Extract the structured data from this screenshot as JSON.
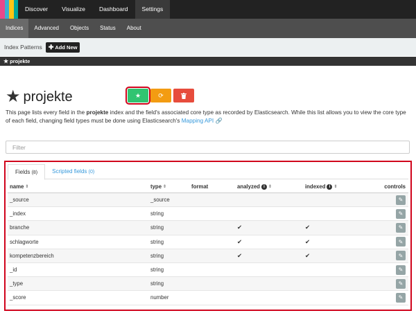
{
  "topnav": {
    "logo_colors": [
      "#e8488b",
      "#3caed2",
      "#fec514",
      "#00a69b"
    ],
    "items": [
      {
        "label": "Discover"
      },
      {
        "label": "Visualize"
      },
      {
        "label": "Dashboard"
      },
      {
        "label": "Settings",
        "active": true
      }
    ]
  },
  "subnav": {
    "items": [
      {
        "label": "Indices",
        "active": true
      },
      {
        "label": "Advanced"
      },
      {
        "label": "Objects"
      },
      {
        "label": "Status"
      },
      {
        "label": "About"
      }
    ]
  },
  "index_patterns": {
    "label": "Index Patterns",
    "add_new": "Add New",
    "add_icon": "plus-icon",
    "selected_pattern": "projekte",
    "selected_icon": "star-icon"
  },
  "header": {
    "title": "projekte",
    "title_icon": "star-icon",
    "buttons": [
      {
        "name": "set-default-button",
        "icon": "star-icon",
        "color": "#31c471"
      },
      {
        "name": "refresh-fields-button",
        "icon": "refresh-icon",
        "color": "#f39c12"
      },
      {
        "name": "delete-pattern-button",
        "icon": "trash-icon",
        "color": "#e74c3c"
      }
    ]
  },
  "description": {
    "pre": "This page lists every field in the ",
    "index": "projekte",
    "mid": " index and the field's associated core type as recorded by Elasticsearch. While this list allows you to view the core type of each field, changing field types must be done using Elasticsearch's ",
    "link": "Mapping API",
    "link_icon": "external-link-icon"
  },
  "filter": {
    "placeholder": "Filter",
    "value": ""
  },
  "tabs": [
    {
      "label": "Fields",
      "count": "(8)",
      "active": true
    },
    {
      "label": "Scripted fields",
      "count": "(0)"
    }
  ],
  "table": {
    "headers": {
      "name": "name",
      "type": "type",
      "format": "format",
      "analyzed": "analyzed",
      "indexed": "indexed",
      "controls": "controls"
    },
    "rows": [
      {
        "name": "_source",
        "type": "_source",
        "format": "",
        "analyzed": false,
        "indexed": false
      },
      {
        "name": "_index",
        "type": "string",
        "format": "",
        "analyzed": false,
        "indexed": false
      },
      {
        "name": "branche",
        "type": "string",
        "format": "",
        "analyzed": true,
        "indexed": true
      },
      {
        "name": "schlagworte",
        "type": "string",
        "format": "",
        "analyzed": true,
        "indexed": true
      },
      {
        "name": "kompetenzbereich",
        "type": "string",
        "format": "",
        "analyzed": true,
        "indexed": true
      },
      {
        "name": "_id",
        "type": "string",
        "format": "",
        "analyzed": false,
        "indexed": false
      },
      {
        "name": "_type",
        "type": "string",
        "format": "",
        "analyzed": false,
        "indexed": false
      },
      {
        "name": "_score",
        "type": "number",
        "format": "",
        "analyzed": false,
        "indexed": false
      }
    ]
  }
}
